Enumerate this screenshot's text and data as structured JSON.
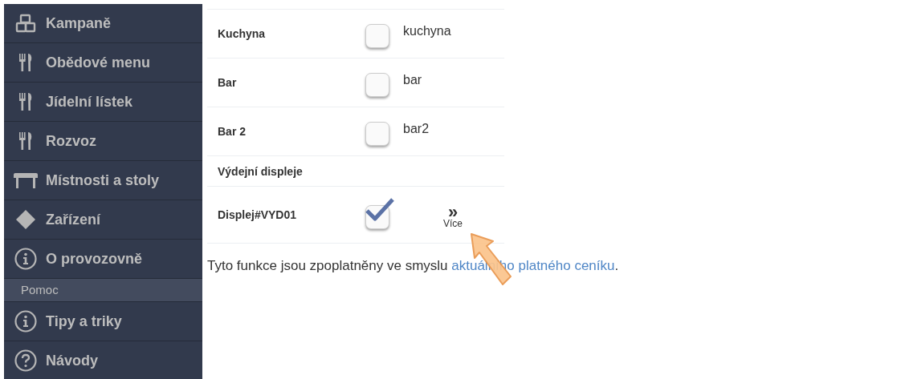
{
  "sidebar": {
    "items": [
      {
        "kind": "item",
        "label": "Kampaně"
      },
      {
        "kind": "item",
        "label": "Obědové menu"
      },
      {
        "kind": "item",
        "label": "Jídelní lístek"
      },
      {
        "kind": "item",
        "label": "Rozvoz"
      },
      {
        "kind": "item",
        "label": "Místnosti a stoly"
      },
      {
        "kind": "item",
        "label": "Zařízení"
      },
      {
        "kind": "item",
        "label": "O provozovně"
      },
      {
        "kind": "section",
        "label": "Pomoc"
      },
      {
        "kind": "item",
        "label": "Tipy a triky"
      },
      {
        "kind": "item",
        "label": "Návody"
      }
    ]
  },
  "rows": [
    {
      "kind": "device",
      "label": "Kuchyna",
      "checked": false,
      "value": "kuchyna"
    },
    {
      "kind": "device",
      "label": "Bar",
      "checked": false,
      "value": "bar"
    },
    {
      "kind": "device",
      "label": "Bar 2",
      "checked": false,
      "value": "bar2"
    },
    {
      "kind": "header",
      "label": "Výdejní displeje"
    },
    {
      "kind": "display",
      "label": "Displej#VYD01",
      "checked": true,
      "more_glyph": "»",
      "more_label": "Více"
    }
  ],
  "footer": {
    "text": "Tyto funkce jsou zpoplatněny ve smyslu ",
    "link": "aktuálního platného ceníku",
    "end": "."
  }
}
